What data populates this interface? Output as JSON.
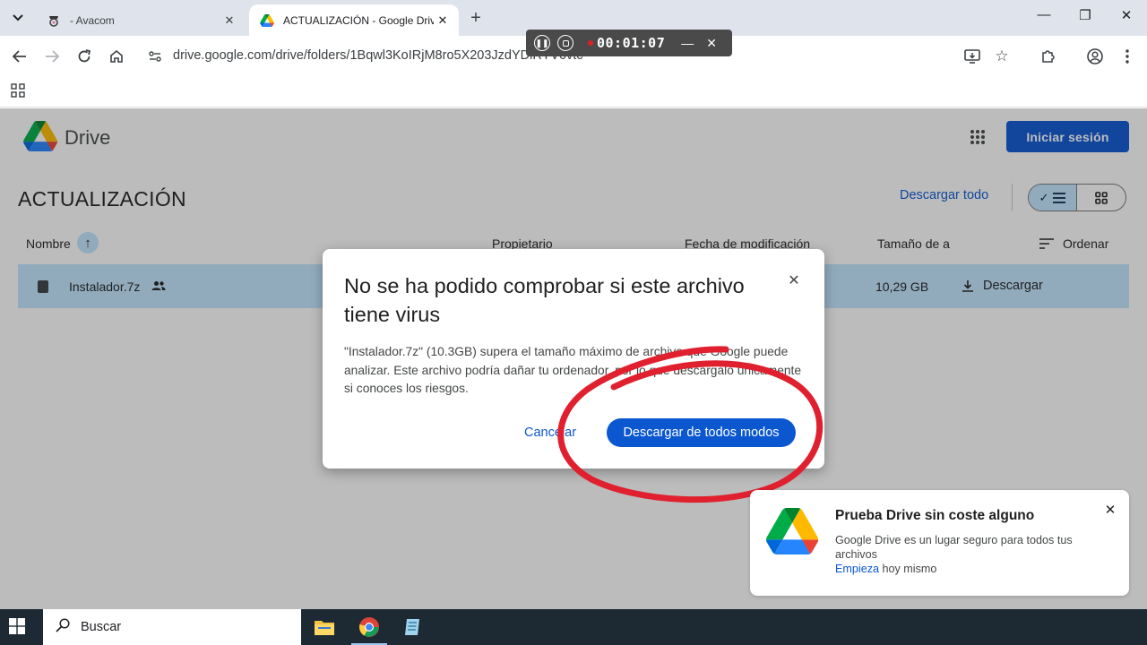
{
  "browser": {
    "tabs": [
      {
        "title": "- Avacom",
        "active": false
      },
      {
        "title": "ACTUALIZACIÓN - Google Drive",
        "active": true
      }
    ],
    "new_tab": "+",
    "url": "drive.google.com/drive/folders/1Bqwl3KoIRjM8ro5X203JzdYDiRYV6vtc",
    "window_controls": {
      "minimize": "—",
      "maximize": "❐",
      "close": "✕"
    }
  },
  "recorder": {
    "time": "00:01:07",
    "minimize": "—",
    "close": "✕"
  },
  "drive": {
    "product_name": "Drive",
    "signin_label": "Iniciar sesión",
    "folder_title": "ACTUALIZACIÓN",
    "download_all_label": "Descargar todo",
    "columns": {
      "name": "Nombre",
      "owner": "Propietario",
      "modified": "Fecha de modificación",
      "size": "Tamaño de a",
      "sort": "Ordenar"
    },
    "files": [
      {
        "name": "Instalador.7z",
        "size": "10,29 GB",
        "action": "Descargar"
      }
    ]
  },
  "dialog": {
    "title": "No se ha podido comprobar si este archivo tiene virus",
    "body": "\"Instalador.7z\" (10.3GB) supera el tamaño máximo de archivo que Google puede analizar. Este archivo podría dañar tu ordenador, por lo que descárgalo únicamente si conoces los riesgos.",
    "cancel_label": "Cancelar",
    "confirm_label": "Descargar de todos modos",
    "close": "✕"
  },
  "promo": {
    "title": "Prueba Drive sin coste alguno",
    "text": "Google Drive es un lugar seguro para todos tus archivos",
    "link_label": "Empieza",
    "link_suffix": " hoy mismo",
    "close": "✕"
  },
  "taskbar": {
    "search_placeholder": "Buscar"
  },
  "colors": {
    "accent": "#0b57d0",
    "selected_row": "#c2e7ff",
    "annotation_red": "#e0202e"
  }
}
